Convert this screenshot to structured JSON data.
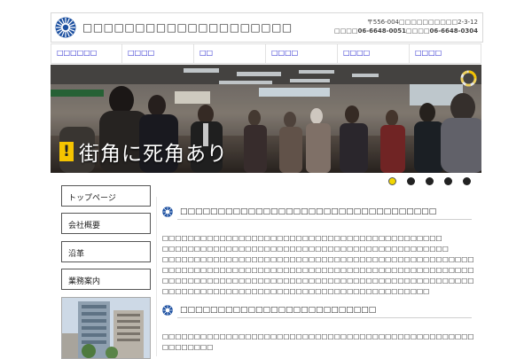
{
  "header": {
    "site_title": "□□□□□□□□□□□□□□□□□□□□",
    "address_line": "〒556-004□□□□□□□□□□2-3-12",
    "tel_label": "□□□□",
    "tel": "06-6648-0051",
    "fax_label": "□□□□",
    "fax": "06-6648-0304"
  },
  "nav": {
    "items": [
      {
        "label": "□□□□□□"
      },
      {
        "label": "□□□□"
      },
      {
        "label": "□□"
      },
      {
        "label": "□□□□"
      },
      {
        "label": "□□□□"
      },
      {
        "label": "□□□□"
      }
    ]
  },
  "hero": {
    "caption": "街角に死角あり",
    "warning_mark": "!"
  },
  "slider": {
    "slide_count": 5,
    "active_index": 0
  },
  "sidebar": {
    "items": [
      {
        "label": "トップページ"
      },
      {
        "label": "会社概要"
      },
      {
        "label": "沿革"
      },
      {
        "label": "業務案内"
      }
    ]
  },
  "main": {
    "section1": {
      "title": "□□□□□□□□□□□□□□□□□□□□□□□□□□□□□□□□□□",
      "lines": [
        "□□□□□□□□□□□□□□□□□□□□□□□□□□□□□□□□□□□□□□□□□□□□",
        "□□□□□□□□□□□□□□□□□□□□□□□□□□□□□□□□□□□□□□□□□□□□□",
        "□□□□□□□□□□□□□□□□□□□□□□□□□□□□□□□□□□□□□□□□□□□□□□□□□",
        "□□□□□□□□□□□□□□□□□□□□□□□□□□□□□□□□□□□□□□□□□□□□□□□□□□□□□□□□□□□□□□□□□□",
        "□□□□□□□□□□□□□□□□□□□□□□□□□□□□□□□□□□□□□□□□□□□□□□□□□□□□□□□□□□□□□□□□□□□□□□□□□□□□□",
        "□□□□□□□□□□□□□□□□□□□□□□□□□□□□□□□□□□□□□□□□□□"
      ]
    },
    "section2": {
      "title": "□□□□□□□□□□□□□□□□□□□□□□□□□□",
      "lines": [
        "□□□□□□□□□□□□□□□□□□□□□□□□□□□□□□□□□□□□□□□□□□□□□□□□□□□□□□□□□□□□□□□□□□□□□□□□□□□□□",
        "□□□□□□□□"
      ]
    }
  },
  "colors": {
    "nav_link": "#2222cc",
    "logo_blue": "#1b4fa0",
    "warning_yellow": "#f5c400",
    "active_dot": "#f2d600"
  }
}
